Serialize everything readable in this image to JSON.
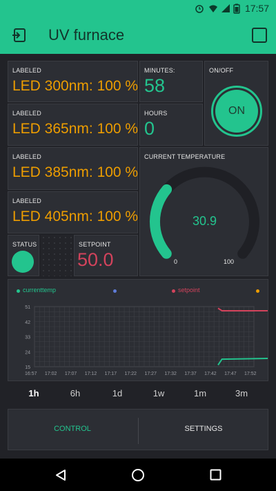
{
  "status_bar": {
    "time": "17:57"
  },
  "app_bar": {
    "title": "UV furnace"
  },
  "leds": [
    {
      "label": "LABELED",
      "value": "LED 300nm: 100 %"
    },
    {
      "label": "LABELED",
      "value": "LED 365nm: 100 %"
    },
    {
      "label": "LABELED",
      "value": "LED 385nm: 100 %"
    },
    {
      "label": "LABELED",
      "value": "LED 405nm: 100 %"
    }
  ],
  "minutes": {
    "label": "MINUTES:",
    "value": "58"
  },
  "hours": {
    "label": "HOURS",
    "value": "0"
  },
  "power": {
    "label": "ON/OFF",
    "button": "ON"
  },
  "temperature": {
    "label": "CURRENT TEMPERATURE",
    "value": "30.9",
    "min": "0",
    "max": "100",
    "fraction": 0.309
  },
  "status": {
    "label": "STATUS"
  },
  "setpoint": {
    "label": "SETPOINT",
    "value": "50.0"
  },
  "chart_data": {
    "type": "line",
    "legend": [
      {
        "name": "currenttemp",
        "color": "#23c48e"
      },
      {
        "name": "",
        "color": "#5f7cd8"
      },
      {
        "name": "setpoint",
        "color": "#d3435c"
      },
      {
        "name": "",
        "color": "#ed9d00"
      }
    ],
    "y_ticks": [
      "51",
      "42",
      "33",
      "24",
      "15"
    ],
    "x_ticks": [
      "16:57",
      "17:02",
      "17:07",
      "17:12",
      "17:17",
      "17:22",
      "17:27",
      "17:32",
      "17:37",
      "17:42",
      "17:47",
      "17:52"
    ],
    "ylim": [
      15,
      51
    ],
    "series": [
      {
        "name": "currenttemp",
        "color": "#23c48e",
        "points": [
          [
            "17:43",
            16
          ],
          [
            "17:44",
            19.5
          ],
          [
            "17:57",
            20
          ]
        ]
      },
      {
        "name": "setpoint",
        "color": "#d3435c",
        "points": [
          [
            "17:43",
            50
          ],
          [
            "17:44",
            48.5
          ],
          [
            "17:57",
            48.5
          ]
        ]
      }
    ]
  },
  "periods": [
    "1h",
    "6h",
    "1d",
    "1w",
    "1m",
    "3m"
  ],
  "active_period": "1h",
  "tabs": {
    "control": "CONTROL",
    "settings": "SETTINGS"
  },
  "colors": {
    "accent": "#23c48e",
    "orange": "#ed9d00",
    "red": "#d3435c",
    "tile": "#2c2e34",
    "background": "#212227"
  }
}
